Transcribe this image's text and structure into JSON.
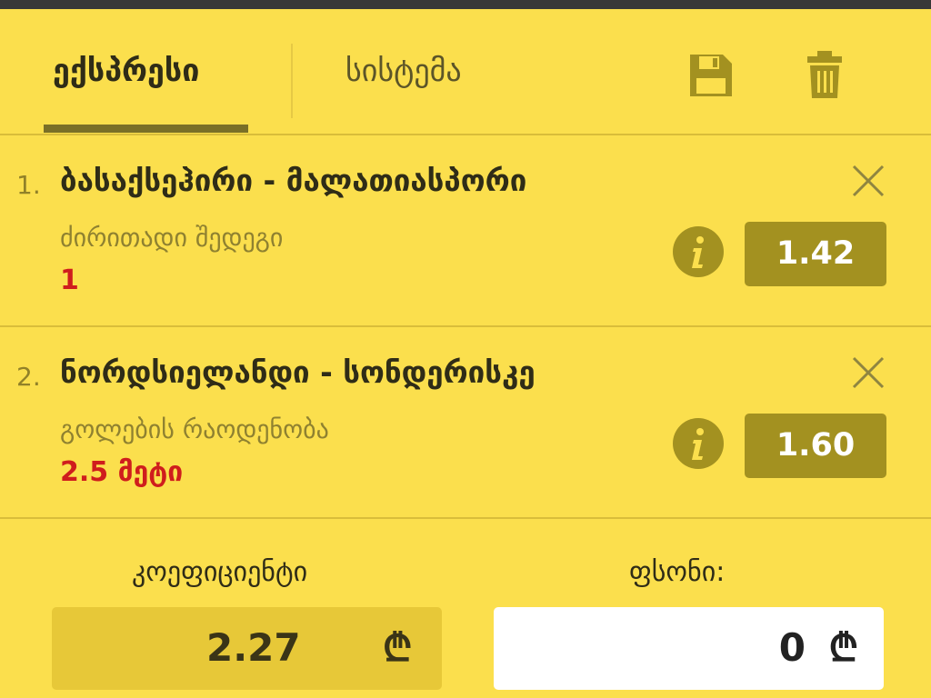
{
  "tabs": [
    {
      "label": "ექსპრესი",
      "active": true
    },
    {
      "label": "სისტემა",
      "active": false
    }
  ],
  "toolbar": {
    "save_icon": "save-icon",
    "trash_icon": "trash-icon"
  },
  "bets": [
    {
      "number": "1.",
      "title": "ბასაქსეჰირი - მალათიასპორი",
      "market": "ძირითადი შედეგი",
      "pick": "1",
      "odds": "1.42"
    },
    {
      "number": "2.",
      "title": "ნორდსიელანდი - სონდერისკე",
      "market": "გოლების რაოდენობა",
      "pick": "2.5 მეტი",
      "odds": "1.60"
    }
  ],
  "summary": {
    "coefficient_label": "კოეფიციენტი",
    "coefficient_value": "2.27",
    "amount_label": "ფსონი:",
    "amount_value": "0",
    "currency_symbol": "₾"
  },
  "colors": {
    "background": "#fbdf4d",
    "accent": "#a39120",
    "pick": "#cf1d1d"
  }
}
